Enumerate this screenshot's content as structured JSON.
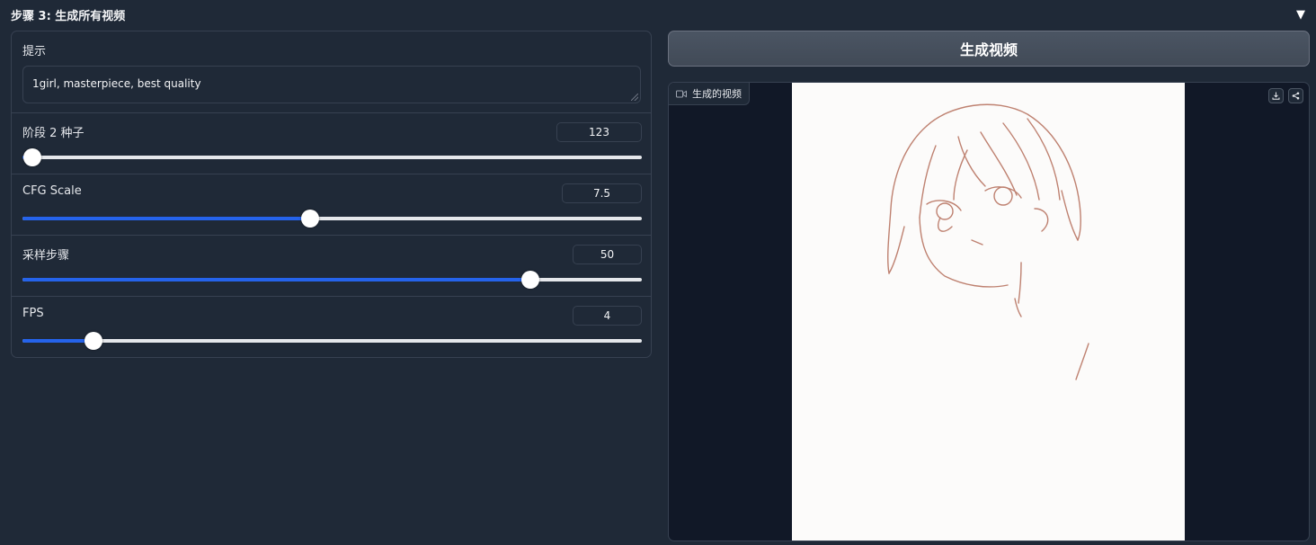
{
  "accordion": {
    "title": "步骤 3: 生成所有视频",
    "toggle_icon": "▼"
  },
  "prompt": {
    "label": "提示",
    "value": "1girl, masterpiece, best quality"
  },
  "sliders": [
    {
      "label": "阶段 2 种子",
      "value": "123",
      "fraction": 0.016
    },
    {
      "label": "CFG Scale",
      "value": "7.5",
      "fraction": 0.465
    },
    {
      "label": "采样步骤",
      "value": "50",
      "fraction": 0.82
    },
    {
      "label": "FPS",
      "value": "4",
      "fraction": 0.114
    }
  ],
  "generate_button": {
    "label": "生成视频"
  },
  "video": {
    "label": "生成的视频",
    "download_icon": "download-icon",
    "share_icon": "share-icon"
  },
  "colors": {
    "accent": "#2563eb",
    "background": "#1f2937",
    "border": "#374151"
  }
}
